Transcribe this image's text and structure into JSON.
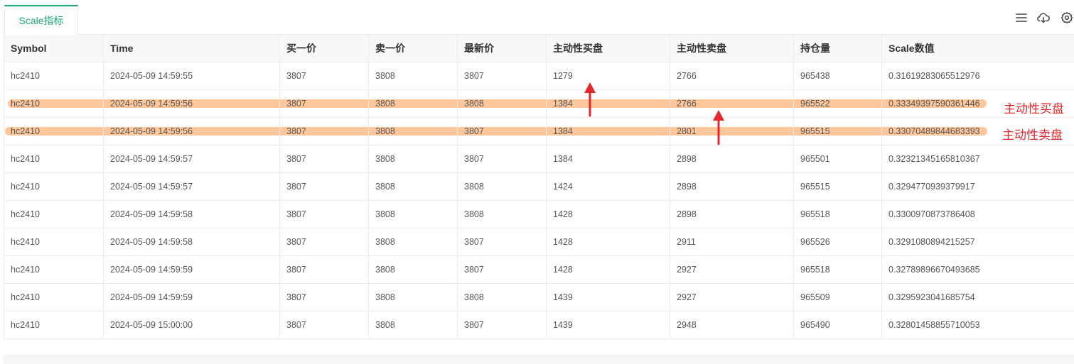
{
  "tab": {
    "label": "Scale指标"
  },
  "toolbar": {
    "icons": [
      "menu-icon",
      "cloud-download-icon",
      "settings-icon"
    ]
  },
  "columns": [
    "Symbol",
    "Time",
    "买一价",
    "卖一价",
    "最新价",
    "主动性买盘",
    "主动性卖盘",
    "持仓量",
    "Scale数值"
  ],
  "rows": [
    [
      "hc2410",
      "2024-05-09 14:59:55",
      "3807",
      "3808",
      "3807",
      "1279",
      "2766",
      "965438",
      "0.31619283065512976"
    ],
    [
      "hc2410",
      "2024-05-09 14:59:56",
      "3807",
      "3808",
      "3808",
      "1384",
      "2766",
      "965522",
      "0.33349397590361446"
    ],
    [
      "hc2410",
      "2024-05-09 14:59:56",
      "3807",
      "3808",
      "3807",
      "1384",
      "2801",
      "965515",
      "0.33070489844683393"
    ],
    [
      "hc2410",
      "2024-05-09 14:59:57",
      "3807",
      "3808",
      "3807",
      "1384",
      "2898",
      "965501",
      "0.32321345165810367"
    ],
    [
      "hc2410",
      "2024-05-09 14:59:57",
      "3807",
      "3808",
      "3808",
      "1424",
      "2898",
      "965515",
      "0.3294770939379917"
    ],
    [
      "hc2410",
      "2024-05-09 14:59:58",
      "3807",
      "3808",
      "3808",
      "1428",
      "2898",
      "965518",
      "0.3300970873786408"
    ],
    [
      "hc2410",
      "2024-05-09 14:59:58",
      "3807",
      "3808",
      "3807",
      "1428",
      "2911",
      "965526",
      "0.3291080894215257"
    ],
    [
      "hc2410",
      "2024-05-09 14:59:59",
      "3807",
      "3808",
      "3807",
      "1428",
      "2927",
      "965518",
      "0.32789896670493685"
    ],
    [
      "hc2410",
      "2024-05-09 14:59:59",
      "3807",
      "3808",
      "3808",
      "1439",
      "2927",
      "965509",
      "0.3295923041685754"
    ],
    [
      "hc2410",
      "2024-05-09 15:00:00",
      "3807",
      "3808",
      "3807",
      "1439",
      "2948",
      "965490",
      "0.32801458855710053"
    ]
  ],
  "annotations": {
    "buy_label": "主动性买盘",
    "sell_label": "主动性卖盘",
    "color": "#e5262c",
    "highlight_color": "#fdc79b"
  }
}
